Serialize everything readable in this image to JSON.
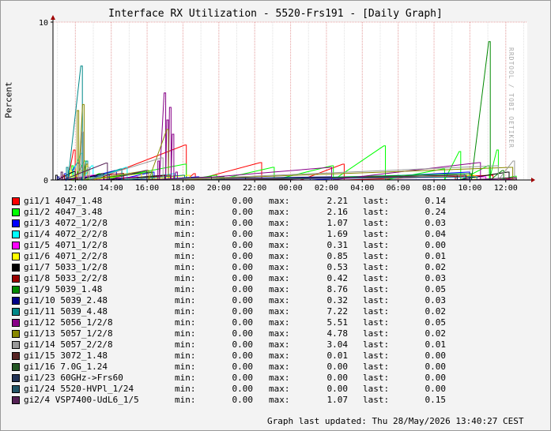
{
  "chart_data": {
    "type": "line",
    "title": "Interface RX Utilization - 5520-Frs191 - [Daily Graph]",
    "ylabel": "Percent",
    "ylim": [
      0,
      10
    ],
    "yticks": [
      "0",
      "10"
    ],
    "x_tick_labels": [
      "12:00",
      "14:00",
      "16:00",
      "18:00",
      "20:00",
      "22:00",
      "00:00",
      "02:00",
      "04:00",
      "06:00",
      "08:00",
      "10:00",
      "12:00"
    ],
    "x_tick_hours": [
      12,
      14,
      16,
      18,
      20,
      22,
      24,
      26,
      28,
      30,
      32,
      34,
      36
    ],
    "x_range_hours": [
      10.75,
      37.2
    ],
    "grid": true,
    "watermark": "RRDTOOL / TOBI OETIKER",
    "series": [
      {
        "name": "gi1/1 4047_1.48",
        "color": "#ff0000",
        "min": "0.00",
        "max": "2.21",
        "last": "0.14",
        "points": [
          [
            11.5,
            0.2
          ],
          [
            11.9,
            1.9
          ],
          [
            12.3,
            0.8
          ],
          [
            13.0,
            0.3
          ],
          [
            18.1,
            2.21
          ],
          [
            18.6,
            0.4
          ],
          [
            22.3,
            1.1
          ],
          [
            24.5,
            0.1
          ],
          [
            26.9,
            1.0
          ],
          [
            35.2,
            0.3
          ],
          [
            36.5,
            0.14
          ]
        ]
      },
      {
        "name": "gi1/2 4047_3.48",
        "color": "#00ff00",
        "min": "0.00",
        "max": "2.16",
        "last": "0.24",
        "points": [
          [
            11.8,
            0.9
          ],
          [
            12.5,
            1.2
          ],
          [
            13.3,
            0.4
          ],
          [
            18.1,
            1.0
          ],
          [
            19.8,
            0.3
          ],
          [
            23.0,
            0.8
          ],
          [
            26.3,
            0.9
          ],
          [
            29.2,
            2.16
          ],
          [
            32.5,
            0.7
          ],
          [
            33.4,
            1.8
          ],
          [
            35.0,
            0.9
          ],
          [
            35.5,
            1.9
          ],
          [
            36.5,
            0.24
          ]
        ]
      },
      {
        "name": "gi1/3 4072_1/2/8",
        "color": "#0000ff",
        "min": "0.00",
        "max": "1.07",
        "last": "0.03",
        "points": [
          [
            11.4,
            0.4
          ],
          [
            12.1,
            1.07
          ],
          [
            14.2,
            0.6
          ],
          [
            16.3,
            0.5
          ],
          [
            18.8,
            0.2
          ],
          [
            25.0,
            0.1
          ],
          [
            33.9,
            0.5
          ],
          [
            36.5,
            0.03
          ]
        ]
      },
      {
        "name": "gi1/4 4072_2/2/8",
        "color": "#00ffff",
        "min": "0.00",
        "max": "1.69",
        "last": "0.04",
        "points": [
          [
            11.6,
            0.6
          ],
          [
            12.3,
            1.69
          ],
          [
            12.9,
            0.9
          ],
          [
            14.8,
            0.8
          ],
          [
            17.5,
            0.4
          ],
          [
            20.0,
            0.2
          ],
          [
            33.6,
            0.4
          ],
          [
            36.5,
            0.04
          ]
        ]
      },
      {
        "name": "gi1/5 4071_1/2/8",
        "color": "#ff00ff",
        "min": "0.00",
        "max": "0.31",
        "last": "0.00",
        "points": [
          [
            11.2,
            0.2
          ],
          [
            13.0,
            0.31
          ],
          [
            15.4,
            0.2
          ],
          [
            19.2,
            0.1
          ],
          [
            34.8,
            0.2
          ],
          [
            36.5,
            0.0
          ]
        ]
      },
      {
        "name": "gi1/6 4071_2/2/8",
        "color": "#ffff00",
        "min": "0.00",
        "max": "0.85",
        "last": "0.01",
        "points": [
          [
            11.7,
            0.6
          ],
          [
            12.6,
            0.85
          ],
          [
            15.6,
            0.4
          ],
          [
            18.3,
            0.3
          ],
          [
            34.2,
            0.3
          ],
          [
            36.5,
            0.01
          ]
        ]
      },
      {
        "name": "gi1/7 5033_1/2/8",
        "color": "#000000",
        "min": "0.00",
        "max": "0.53",
        "last": "0.02",
        "points": [
          [
            10.9,
            0.3
          ],
          [
            11.9,
            0.53
          ],
          [
            13.5,
            0.4
          ],
          [
            16.9,
            0.3
          ],
          [
            21.4,
            0.2
          ],
          [
            33.2,
            0.3
          ],
          [
            36.1,
            0.5
          ],
          [
            36.5,
            0.02
          ]
        ]
      },
      {
        "name": "gi1/8 5033_2/2/8",
        "color": "#990000",
        "min": "0.00",
        "max": "0.42",
        "last": "0.03",
        "points": [
          [
            11.3,
            0.3
          ],
          [
            14.6,
            0.42
          ],
          [
            17.2,
            0.3
          ],
          [
            33.1,
            0.2
          ],
          [
            36.5,
            0.03
          ]
        ]
      },
      {
        "name": "gi1/9 5039_1.48",
        "color": "#008800",
        "min": "0.00",
        "max": "8.76",
        "last": "0.05",
        "points": [
          [
            12.4,
            0.6
          ],
          [
            16.2,
            0.5
          ],
          [
            20.2,
            0.2
          ],
          [
            34.0,
            0.4
          ],
          [
            35.05,
            8.76
          ],
          [
            35.8,
            0.6
          ],
          [
            36.5,
            0.05
          ]
        ]
      },
      {
        "name": "gi1/10 5039_2.48",
        "color": "#000088",
        "min": "0.00",
        "max": "0.32",
        "last": "0.03",
        "points": [
          [
            11.0,
            0.2
          ],
          [
            13.8,
            0.32
          ],
          [
            26.2,
            0.2
          ],
          [
            36.5,
            0.03
          ]
        ]
      },
      {
        "name": "gi1/11 5039_4.48",
        "color": "#008888",
        "min": "0.00",
        "max": "7.22",
        "last": "0.02",
        "points": [
          [
            11.5,
            0.8
          ],
          [
            12.3,
            7.22
          ],
          [
            12.6,
            1.2
          ],
          [
            14.5,
            0.7
          ],
          [
            18.0,
            0.3
          ],
          [
            34.3,
            0.2
          ],
          [
            36.5,
            0.02
          ]
        ]
      },
      {
        "name": "gi1/12 5056_1/2/8",
        "color": "#880088",
        "min": "0.00",
        "max": "5.51",
        "last": "0.05",
        "points": [
          [
            16.6,
            1.2
          ],
          [
            16.95,
            5.51
          ],
          [
            17.1,
            3.8
          ],
          [
            17.25,
            4.6
          ],
          [
            17.4,
            2.9
          ],
          [
            17.6,
            0.5
          ],
          [
            26.2,
            0.8
          ],
          [
            34.5,
            1.1
          ],
          [
            36.5,
            0.05
          ]
        ]
      },
      {
        "name": "gi1/13 5057_1/2/8",
        "color": "#888800",
        "min": "0.00",
        "max": "4.78",
        "last": "0.02",
        "points": [
          [
            12.1,
            4.4
          ],
          [
            12.4,
            4.78
          ],
          [
            12.6,
            1.0
          ],
          [
            16.0,
            0.6
          ],
          [
            17.1,
            3.2
          ],
          [
            36.3,
            0.8
          ],
          [
            36.5,
            0.02
          ]
        ]
      },
      {
        "name": "gi1/14 5057_2/2/8",
        "color": "#999999",
        "min": "0.00",
        "max": "3.04",
        "last": "0.01",
        "points": [
          [
            12.2,
            1.0
          ],
          [
            12.35,
            3.04
          ],
          [
            12.7,
            0.8
          ],
          [
            16.8,
            1.4
          ],
          [
            35.5,
            0.9
          ],
          [
            36.4,
            1.2
          ],
          [
            36.5,
            0.01
          ]
        ]
      },
      {
        "name": "gi1/15 3072_1.48",
        "color": "#552222",
        "min": "0.00",
        "max": "0.01",
        "last": "0.00",
        "points": [
          [
            12.0,
            0.01
          ],
          [
            24.0,
            0.01
          ],
          [
            36.5,
            0.0
          ]
        ]
      },
      {
        "name": "gi1/16 7.0G_1.24",
        "color": "#225522",
        "min": "0.00",
        "max": "0.00",
        "last": "0.00",
        "points": [
          [
            11.0,
            0.0
          ],
          [
            36.5,
            0.0
          ]
        ]
      },
      {
        "name": "gi1/23 60GHz->Frs60",
        "color": "#223355",
        "min": "0.00",
        "max": "0.00",
        "last": "0.00",
        "points": [
          [
            11.0,
            0.0
          ],
          [
            36.5,
            0.0
          ]
        ]
      },
      {
        "name": "gi1/24 5520-HVPl_1/24",
        "color": "#225566",
        "min": "0.00",
        "max": "0.00",
        "last": "0.00",
        "points": [
          [
            11.0,
            0.0
          ],
          [
            36.5,
            0.0
          ]
        ]
      },
      {
        "name": "gi2/4 VSP7400-UdL6_1/5",
        "color": "#552255",
        "min": "0.00",
        "max": "1.07",
        "last": "0.15",
        "points": [
          [
            11.2,
            0.5
          ],
          [
            13.7,
            1.07
          ],
          [
            15.9,
            0.6
          ],
          [
            19.5,
            0.2
          ],
          [
            33.7,
            0.3
          ],
          [
            36.5,
            0.15
          ]
        ]
      }
    ]
  },
  "legend_labels": {
    "min": "min:",
    "max": "max:",
    "last": "last:"
  },
  "footer": {
    "updated": "Graph last updated: Thu 28/May/2026 13:40:27 CEST"
  }
}
